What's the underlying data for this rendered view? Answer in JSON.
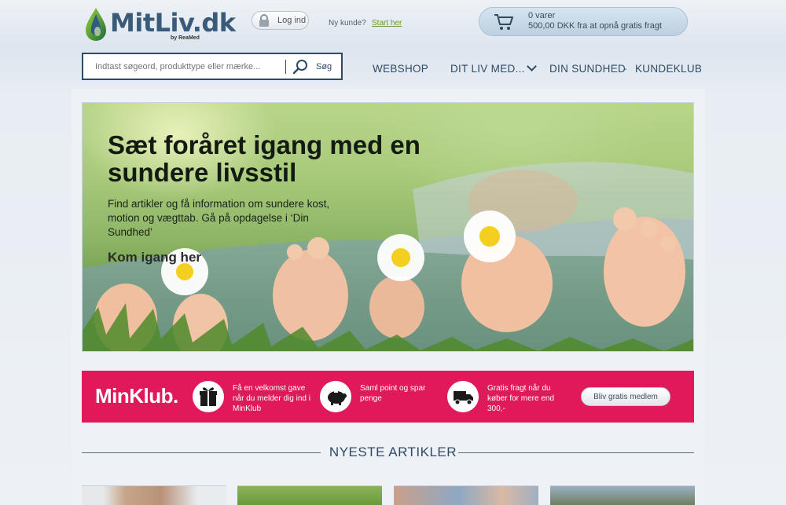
{
  "header": {
    "logo_text": "MitLiv.dk",
    "logo_by": "by ReaMed",
    "login_label": "Log ind",
    "new_customer_label": "Ny kunde?",
    "start_link": "Start her",
    "cart": {
      "count": "0 varer",
      "shipping_info": "500,00 DKK fra at opnå gratis fragt"
    }
  },
  "search": {
    "placeholder": "Indtast søgeord, produkttype eller mærke...",
    "button_label": "Søg"
  },
  "nav": {
    "items": [
      {
        "label": "WEBSHOP"
      },
      {
        "label": "DIT LIV MED..."
      },
      {
        "label": "DIN SUNDHED"
      },
      {
        "label": "KUNDEKLUB"
      }
    ],
    "separator": "·"
  },
  "hero": {
    "title": "Sæt foråret igang med en sundere livsstil",
    "text": "Find artikler og få information om sundere kost, motion og vægttab. Gå på opdagelse i ‘Din Sundhed’",
    "cta": "Kom igang her"
  },
  "minklub": {
    "logo": "MinKlub.",
    "features": [
      {
        "icon": "gift-icon",
        "text": "Få en velkomst gave når du melder dig ind i MinKlub"
      },
      {
        "icon": "piggy-bank-icon",
        "text": "Saml point og spar penge"
      },
      {
        "icon": "truck-icon",
        "text": "Gratis fragt når du køber for mere end 300,-"
      }
    ],
    "button_label": "Bliv gratis medlem",
    "accent_color": "#e0195a"
  },
  "articles": {
    "heading": "NYESTE ARTIKLER"
  },
  "colors": {
    "brand_navy": "#2f4a66",
    "link_green": "#6a9a2a"
  }
}
